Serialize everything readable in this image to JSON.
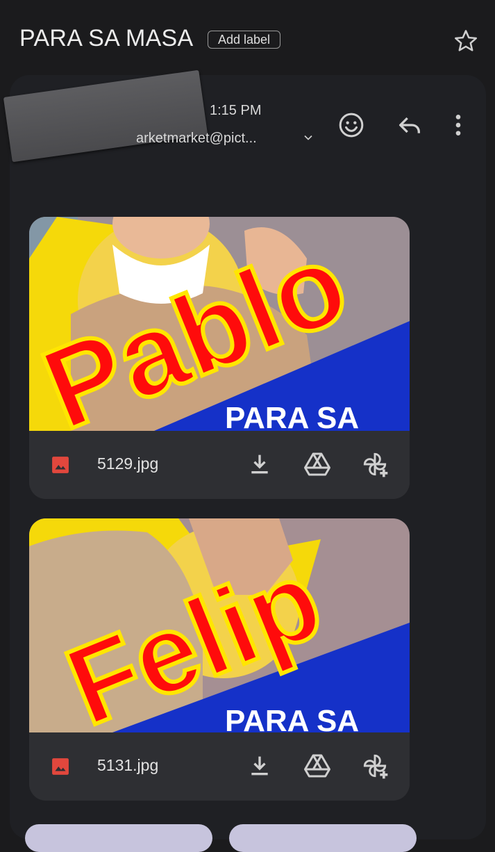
{
  "header": {
    "subject": "PARA SA MASA",
    "add_label": "Add label",
    "icons": [
      "star-icon"
    ]
  },
  "message": {
    "time": "1:15 PM",
    "sender_email": "arketmarket@pict...",
    "icons": [
      "avatar",
      "chevron-down-icon",
      "emoji-icon",
      "reply-icon",
      "more-vert-icon"
    ]
  },
  "attachments": [
    {
      "filename": "5129.jpg",
      "thumb_name": "Pablo",
      "thumb_tagline": "PARA SA"
    },
    {
      "filename": "5131.jpg",
      "thumb_name": "Felip",
      "thumb_tagline": "PARA SA"
    }
  ],
  "attachment_actions": [
    "download-icon",
    "drive-icon",
    "add-to-photos-icon"
  ],
  "colors": {
    "background": "#1b1b1d",
    "card": "#1f2024",
    "attachment_bar": "#2e2f33",
    "poster_yellow": "#f5d90a",
    "poster_red": "#ff0b0b",
    "poster_blue": "#1531c8",
    "image_icon_red": "#e1473d",
    "bottom_pill": "#c7c4dd"
  }
}
